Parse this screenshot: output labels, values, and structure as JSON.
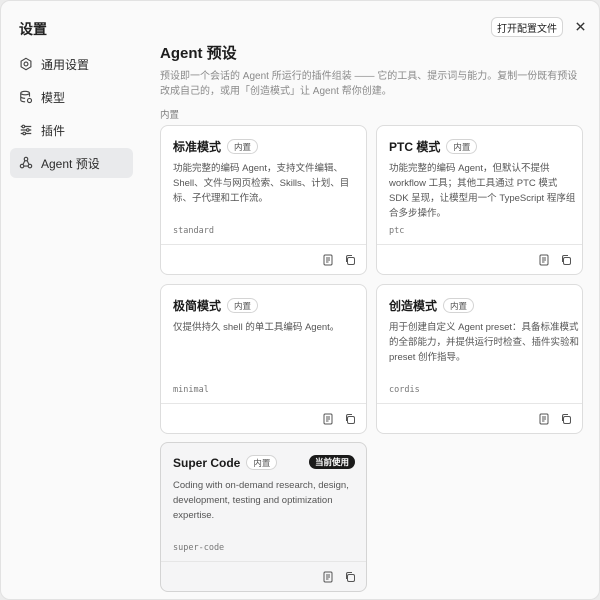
{
  "sidebar": {
    "title": "设置",
    "items": [
      {
        "label": "通用设置",
        "icon": "gear-icon"
      },
      {
        "label": "模型",
        "icon": "database-icon"
      },
      {
        "label": "插件",
        "icon": "sliders-icon"
      },
      {
        "label": "Agent 预设",
        "icon": "agent-icon",
        "active": true
      }
    ]
  },
  "header": {
    "open_config_label": "打开配置文件",
    "close_icon": "close-icon"
  },
  "main": {
    "title": "Agent 预设",
    "description": "预设即一个会话的 Agent 所运行的插件组装 —— 它的工具、提示词与能力。复制一份既有预设改成自己的，或用「创造模式」让 Agent 帮你创建。",
    "section_label": "内置",
    "cards": [
      {
        "title": "标准模式",
        "badge": "内置",
        "description": "功能完整的编码 Agent，支持文件编辑、Shell、文件与网页检索、Skills、计划、目标、子代理和工作流。",
        "id": "standard"
      },
      {
        "title": "PTC 模式",
        "badge": "内置",
        "description": "功能完整的编码 Agent，但默认不提供 workflow 工具；其他工具通过 PTC 模式 SDK 呈现，让模型用一个 TypeScript 程序组合多步操作。",
        "id": "ptc"
      },
      {
        "title": "极简模式",
        "badge": "内置",
        "description": "仅提供持久 shell 的单工具编码 Agent。",
        "id": "minimal"
      },
      {
        "title": "创造模式",
        "badge": "内置",
        "description": "用于创建自定义 Agent preset：具备标准模式的全部能力，并提供运行时检查、插件实验和 preset 创作指导。",
        "id": "cordis"
      },
      {
        "title": "Super Code",
        "badge": "内置",
        "current_badge": "当前使用",
        "description": "Coding with on-demand research, design, development, testing and optimization expertise.",
        "id": "super-code"
      }
    ]
  }
}
